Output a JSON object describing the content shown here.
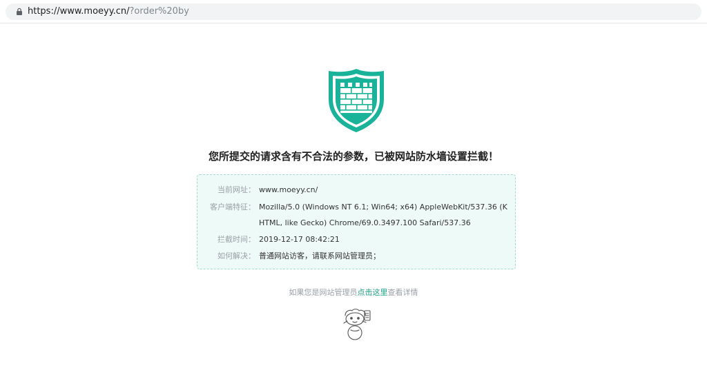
{
  "browser": {
    "url_host": "https://www.moeyy.cn/",
    "url_path": "?order%20by"
  },
  "page": {
    "headline": "您所提交的请求含有不合法的参数，已被网站防水墙设置拦截！",
    "info": {
      "url_label": "当前网址：",
      "url_value": "www.moeyy.cn/",
      "ua_label": "客户端特征：",
      "ua_value": "Mozilla/5.0 (Windows NT 6.1; Win64; x64) AppleWebKit/537.36 (KHTML, like Gecko) Chrome/69.0.3497.100 Safari/537.36",
      "time_label": "拦截时间：",
      "time_value": "2019-12-17 08:42:21",
      "solve_label": "如何解决：",
      "solve_value": "普通网站访客，请联系网站管理员；"
    },
    "admin_note": {
      "prefix": "如果您是网站管理员",
      "link": "点击这里",
      "suffix": "查看详情"
    }
  },
  "icons": {
    "shield": "shield-brick-wall-icon",
    "lock": "lock-icon",
    "mascot": "mascot-icon"
  },
  "colors": {
    "accent": "#19b399",
    "box_bg": "#eefaf8",
    "link": "#1aa085"
  }
}
